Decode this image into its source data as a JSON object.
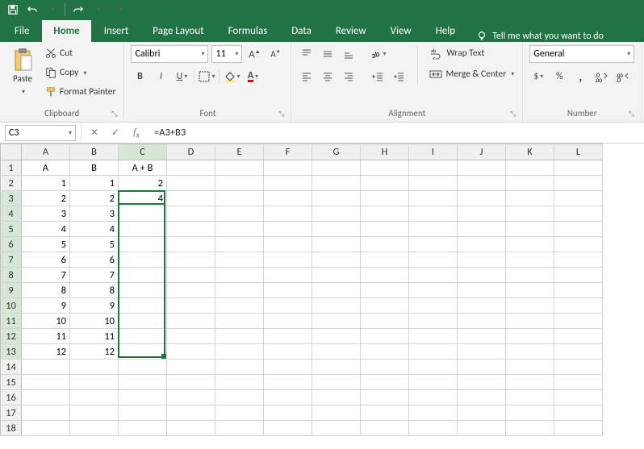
{
  "qat": {
    "save_icon": "save-icon",
    "undo_icon": "undo-icon",
    "redo_icon": "redo-icon"
  },
  "tabs": {
    "file": "File",
    "home": "Home",
    "insert": "Insert",
    "page_layout": "Page Layout",
    "formulas": "Formulas",
    "data": "Data",
    "review": "Review",
    "view": "View",
    "help": "Help",
    "tell_me": "Tell me what you want to do"
  },
  "ribbon": {
    "clipboard": {
      "label": "Clipboard",
      "paste": "Paste",
      "cut": "Cut",
      "copy": "Copy",
      "format_painter": "Format Painter"
    },
    "font": {
      "label": "Font",
      "name": "Calibri",
      "size": "11",
      "bold": "B",
      "italic": "I",
      "underline": "U"
    },
    "alignment": {
      "label": "Alignment",
      "wrap": "Wrap Text",
      "merge": "Merge & Center"
    },
    "number": {
      "label": "Number",
      "format": "General",
      "percent": "%"
    }
  },
  "namebox": "C3",
  "formula": "=A3+B3",
  "columns": [
    "A",
    "B",
    "C",
    "D",
    "E",
    "F",
    "G",
    "H",
    "I",
    "J",
    "K",
    "L"
  ],
  "rows": [
    "1",
    "2",
    "3",
    "4",
    "5",
    "6",
    "7",
    "8",
    "9",
    "10",
    "11",
    "12",
    "13",
    "14",
    "15",
    "16",
    "17",
    "18"
  ],
  "cells": {
    "A1": "A",
    "B1": "B",
    "C1": "A + B",
    "A2": "1",
    "B2": "1",
    "C2": "2",
    "A3": "2",
    "B3": "2",
    "C3": "4",
    "A4": "3",
    "B4": "3",
    "A5": "4",
    "B5": "4",
    "A6": "5",
    "B6": "5",
    "A7": "6",
    "B7": "6",
    "A8": "7",
    "B8": "7",
    "A9": "8",
    "B9": "8",
    "A10": "9",
    "B10": "9",
    "A11": "10",
    "B11": "10",
    "A12": "11",
    "B12": "11",
    "A13": "12",
    "B13": "12"
  },
  "selection": {
    "col": "C",
    "rowStart": 3,
    "rowEnd": 13
  },
  "active_cell": {
    "col": "C",
    "row": 3
  },
  "text_cells": [
    "A1",
    "B1",
    "C1"
  ],
  "selected_col_headers": [
    "C"
  ],
  "selected_row_headers": [
    "3",
    "4",
    "5",
    "6",
    "7",
    "8",
    "9",
    "10",
    "11",
    "12",
    "13"
  ]
}
